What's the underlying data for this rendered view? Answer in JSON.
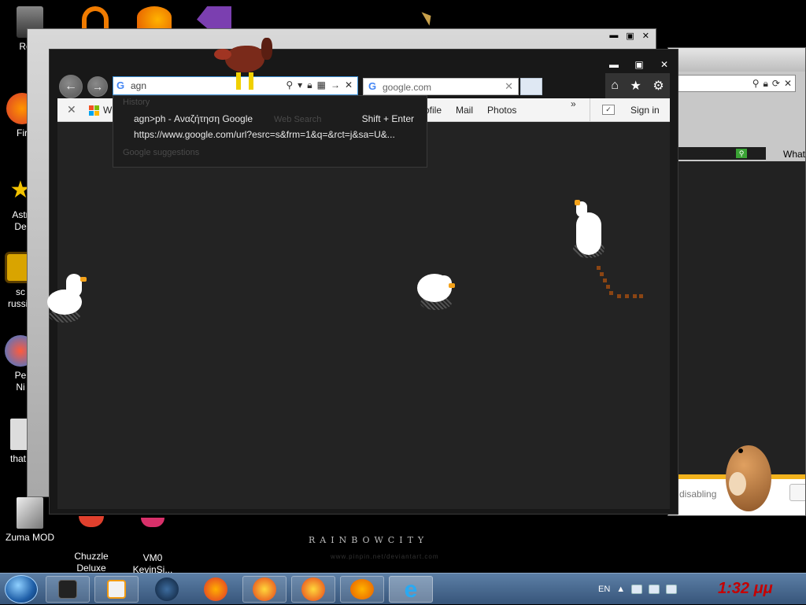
{
  "desktop": {
    "icons": [
      {
        "label": "Recy"
      },
      {
        "label": "Fir"
      },
      {
        "label": "Astr\nDe"
      },
      {
        "label": "sc\nrussia"
      },
      {
        "label": "Pe\nNi"
      },
      {
        "label": "that b"
      },
      {
        "label": "Zuma MOD"
      },
      {
        "label": "Chuzzle\nDeluxe"
      },
      {
        "label": "VM0\nKevinSi..."
      }
    ],
    "wallpaper_brand": "RAINBOWCITY",
    "wallpaper_url": "www.pinpin.net/deviantart.com"
  },
  "browser": {
    "address": {
      "value": "agn",
      "placeholder": ""
    },
    "tab": {
      "title": "google.com"
    },
    "favorites": {
      "partial_first": "W",
      "links": [
        "ofile",
        "Mail",
        "Photos"
      ],
      "more": "»",
      "sign_in": "Sign in"
    },
    "suggestions": {
      "faded_top": "History",
      "rows": [
        {
          "text": "agn>ph - Αναζήτηση Google",
          "shortcut": "Shift + Enter"
        },
        {
          "text": "https://www.google.com/url?esrc=s&frm=1&q=&rct=j&sa=U&..."
        }
      ],
      "faded_search": "Web Search",
      "faded_bottom": "Google suggestions"
    }
  },
  "right_window": {
    "what_text": "What",
    "disabling_text": "disabling"
  },
  "taskbar": {
    "language": "EN",
    "clock": "1:32 μμ"
  },
  "colors": {
    "taskbar": "#4a6d93",
    "clock": "#c50000",
    "accent_blue": "#3b8fd6",
    "goose_beak": "#f4a21a"
  }
}
